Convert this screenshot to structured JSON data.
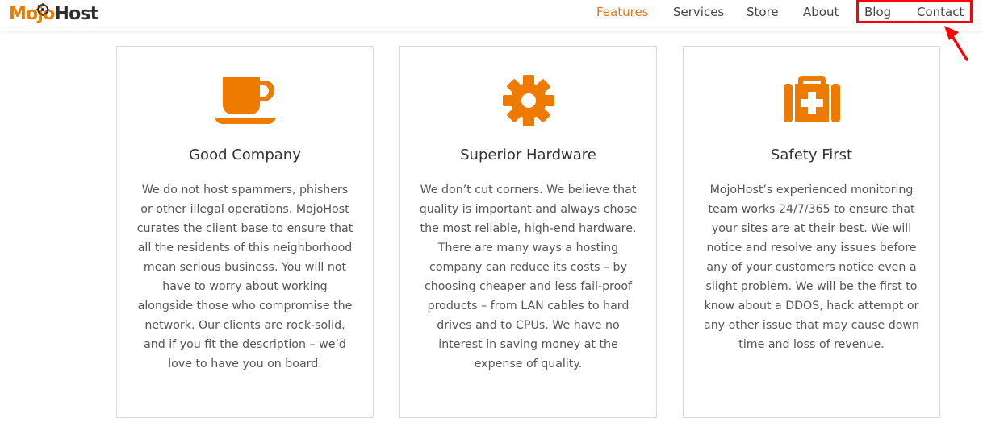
{
  "brand": {
    "logo_mo": "Mo",
    "logo_jo": "jo",
    "logo_host": "Host"
  },
  "nav": {
    "items": [
      {
        "label": "Features",
        "active": true
      },
      {
        "label": "Services",
        "active": false
      },
      {
        "label": "Store",
        "active": false
      },
      {
        "label": "About",
        "active": false
      },
      {
        "label": "Blog",
        "active": false
      },
      {
        "label": "Contact",
        "active": false
      }
    ]
  },
  "colors": {
    "accent": "#ee7b00",
    "annotation": "#ff0000"
  },
  "features": [
    {
      "icon": "coffee-cup-icon",
      "title": "Good Company",
      "body": "We do not host spammers, phishers or other illegal operations. MojoHost curates the client base to ensure that all the residents of this neighborhood mean serious business. You will not have to worry about working alongside those who compromise the network. Our clients are rock-solid, and if you fit the description – we’d love to have you on board."
    },
    {
      "icon": "gear-icon",
      "title": "Superior Hardware",
      "body": "We don’t cut corners. We believe that quality is important and always chose the most reliable, high-end hardware. There are many ways a hosting company can reduce its costs – by choosing cheaper and less fail-proof products – from LAN cables to hard drives and to CPUs. We have no interest in saving money at the expense of quality."
    },
    {
      "icon": "medkit-icon",
      "title": "Safety First",
      "body": "MojoHost’s experienced monitoring team works 24/7/365 to ensure that your sites are at their best. We will notice and resolve any issues before any of your customers notice even a slight problem. We will be the first to know about a DDOS, hack attempt or any other issue that may cause down time and loss of revenue."
    }
  ]
}
